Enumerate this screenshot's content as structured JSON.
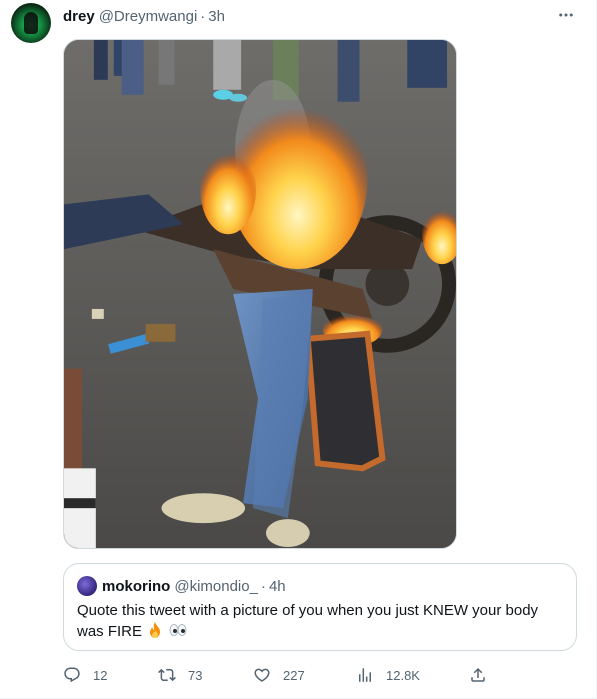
{
  "tweet": {
    "author_name": "drey",
    "author_handle": "@Dreymwangi",
    "separator": "·",
    "time": "3h"
  },
  "quoted_tweet": {
    "author_name": "mokorino",
    "author_handle": "@kimondio_",
    "separator": "·",
    "time": "4h",
    "text": "Quote this tweet with a picture of you when you just KNEW your body was FIRE",
    "emojis": [
      "fire",
      "eyes"
    ]
  },
  "actions": {
    "replies": "12",
    "retweets": "73",
    "likes": "227",
    "views": "12.8K"
  },
  "icons": {
    "more": "more-horizontal-icon",
    "reply": "reply-icon",
    "retweet": "retweet-icon",
    "like": "heart-icon",
    "views": "views-chart-icon",
    "share": "share-icon"
  },
  "colors": {
    "text_primary": "#0f1419",
    "text_secondary": "#536471",
    "border": "#cfd9de"
  }
}
